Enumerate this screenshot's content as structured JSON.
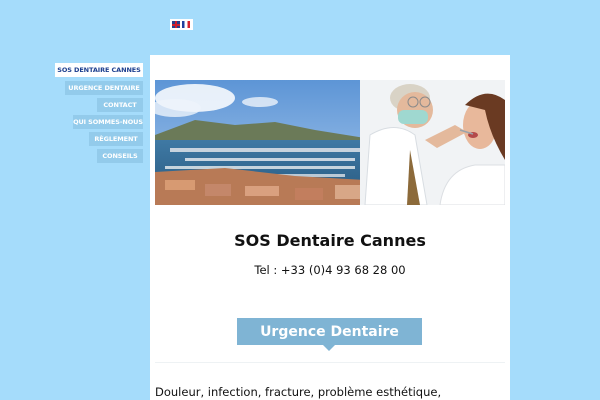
{
  "languages": [
    {
      "name": "english-flag"
    },
    {
      "name": "french-flag"
    }
  ],
  "nav": {
    "items": [
      {
        "label": "SOS DENTAIRE CANNES",
        "active": true
      },
      {
        "label": "URGENCE DENTAIRE",
        "active": false
      },
      {
        "label": "CONTACT",
        "active": false
      },
      {
        "label": "QUI SOMMES-NOUS",
        "active": false
      },
      {
        "label": "RÈGLEMENT",
        "active": false
      },
      {
        "label": "CONSEILS",
        "active": false
      }
    ]
  },
  "main": {
    "title": "SOS Dentaire Cannes",
    "phone": "Tel : +33 (0)4 93 68 28 00",
    "section_heading": "Urgence Dentaire",
    "intro_text": "Douleur, infection, fracture, problème esthétique,"
  },
  "colors": {
    "background": "#a5dcfb",
    "nav_inactive": "#93cbeb",
    "nav_active_text": "#1d3f8f",
    "heading_bg": "#7fb4d4"
  }
}
